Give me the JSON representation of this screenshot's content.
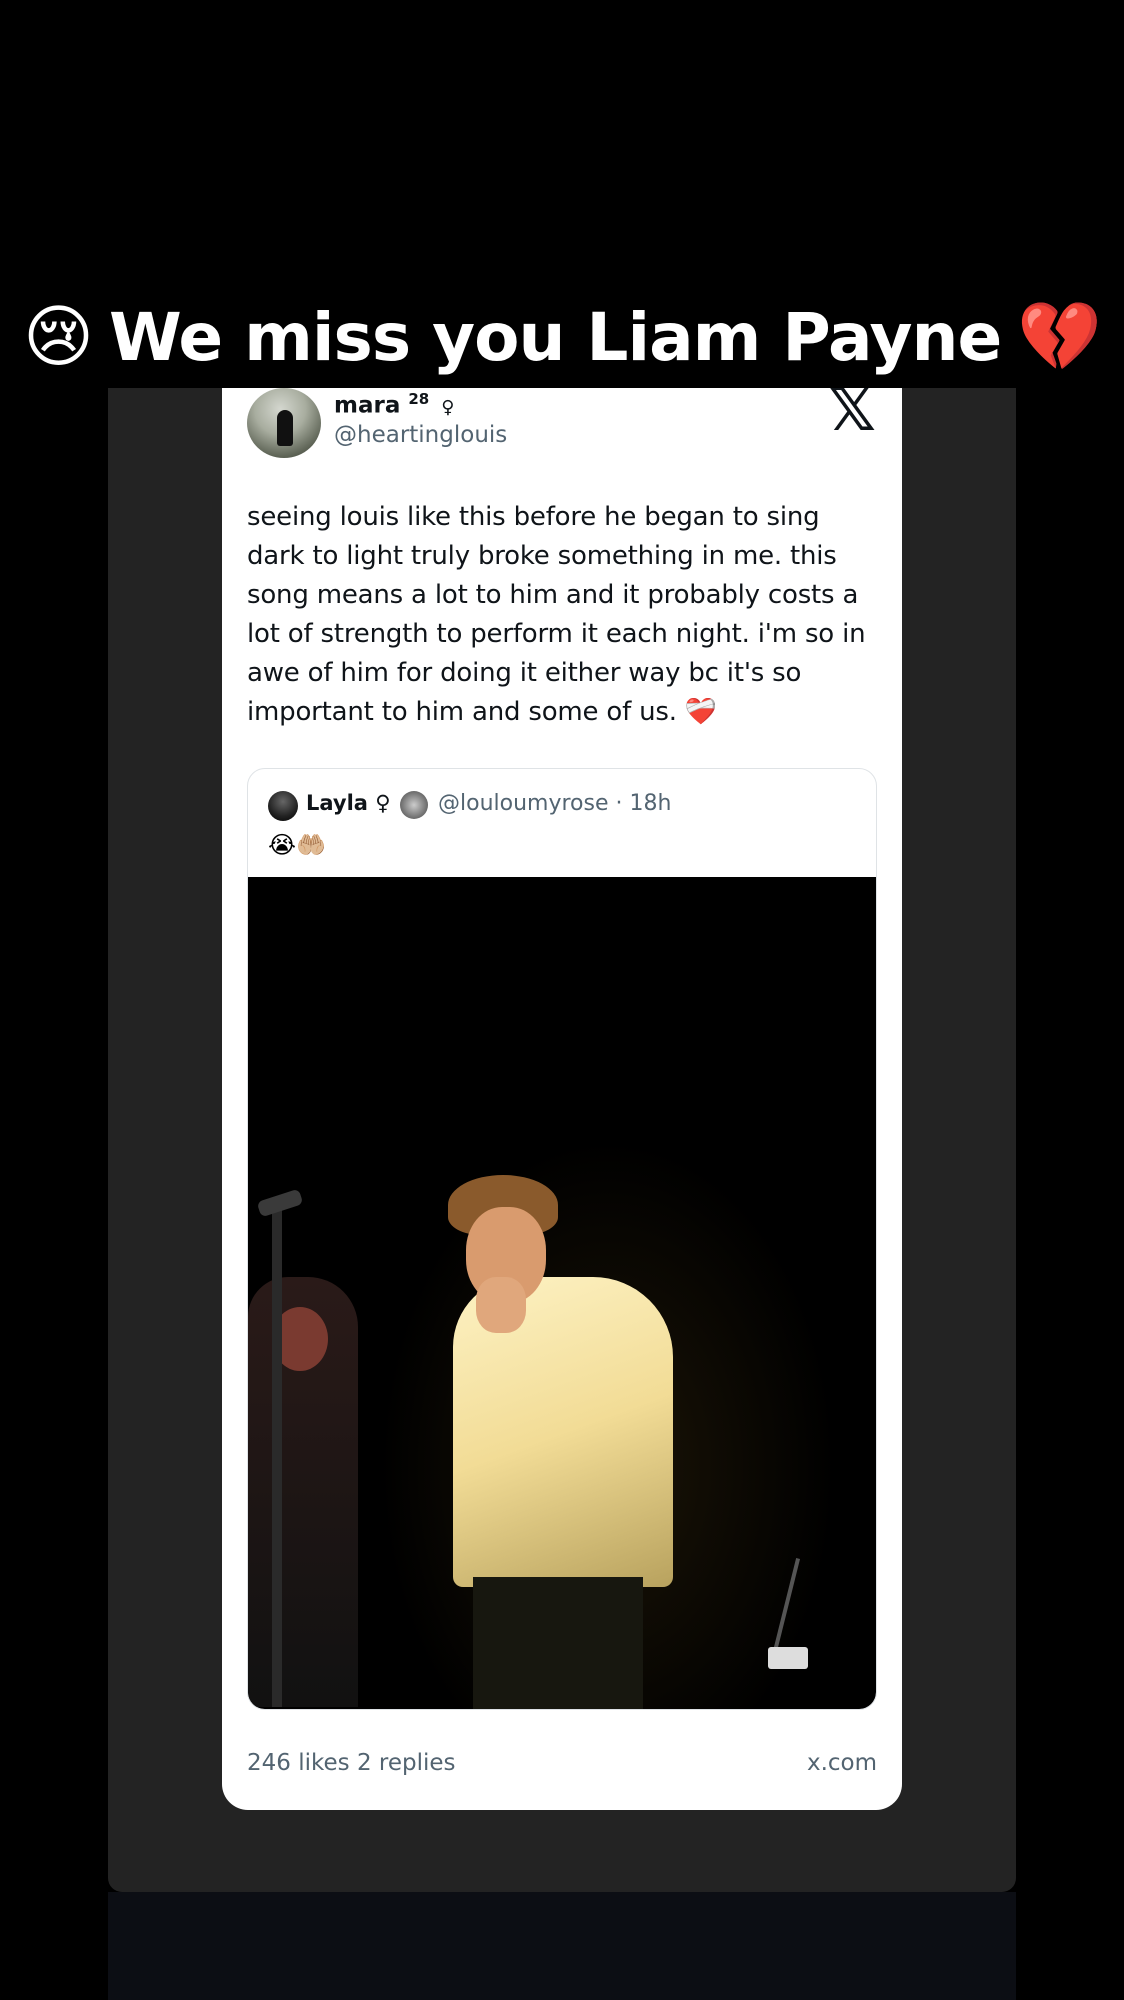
{
  "caption": {
    "emoji_left": "😢",
    "text": "We miss you Liam Payne",
    "emoji_right": "💔"
  },
  "tweet": {
    "name": "mara",
    "name_superscript": "28",
    "name_symbol": "♀",
    "handle": "@heartinglouis",
    "platform_logo": "𝕏",
    "text": "seeing louis like this before he began to sing dark to light truly broke something in me. this song means a lot to him and it probably costs a lot of strength to perform it each night. i'm so in awe of him for doing it either way bc it's so important to him and some of us.",
    "text_emoji": "❤️‍🩹",
    "quote": {
      "name": "Layla",
      "name_symbol": "♀",
      "handle_time": "@louloumyrose · 18h",
      "emojis": "😭🤲🏼"
    },
    "likes": "246 likes",
    "replies": "2 replies",
    "source": "x.com"
  }
}
